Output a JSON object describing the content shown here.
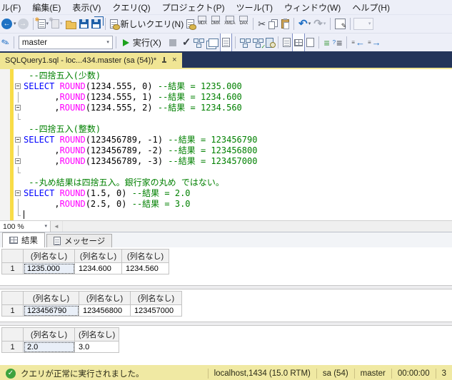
{
  "menu_bar": {
    "items": [
      "ル(F)",
      "編集(E)",
      "表示(V)",
      "クエリ(Q)",
      "プロジェクト(P)",
      "ツール(T)",
      "ウィンドウ(W)",
      "ヘルプ(H)"
    ]
  },
  "toolbar_main": {
    "new_query_label": "新しいクエリ(N)",
    "query_types": [
      "MDX",
      "DMX",
      "XMLA",
      "DAX"
    ]
  },
  "toolbar_editor": {
    "database": "master",
    "execute_label": "実行(X)"
  },
  "tab_strip": {
    "active_tab_title": "SQLQuery1.sql - loc...434.master (sa (54))*"
  },
  "editor": {
    "zoom_level": "100 %",
    "colors": {
      "keyword": "#0000FF",
      "function": "#FF00FF",
      "comment": "#008000",
      "change_bar": "#F8DC47"
    },
    "lines": [
      {
        "fold": "none",
        "segs": [
          [
            " --四捨五入(少数)",
            "cm"
          ]
        ]
      },
      {
        "fold": "minus",
        "segs": [
          [
            "SELECT ",
            "kw"
          ],
          [
            "ROUND",
            "fn"
          ],
          [
            "(1234.555, 0) ",
            "pl"
          ],
          [
            "--結果 = 1235.000",
            "cm"
          ]
        ]
      },
      {
        "fold": "line",
        "segs": [
          [
            "      ,",
            "pl"
          ],
          [
            "ROUND",
            "fn"
          ],
          [
            "(1234.555, 1) ",
            "pl"
          ],
          [
            "--結果 = 1234.600",
            "cm"
          ]
        ]
      },
      {
        "fold": "minus",
        "segs": [
          [
            "      ,",
            "pl"
          ],
          [
            "ROUND",
            "fn"
          ],
          [
            "(1234.555, 2) ",
            "pl"
          ],
          [
            "--結果 = 1234.560",
            "cm"
          ]
        ]
      },
      {
        "fold": "end",
        "segs": []
      },
      {
        "fold": "none",
        "segs": [
          [
            " --四捨五入(整数)",
            "cm"
          ]
        ]
      },
      {
        "fold": "minus",
        "segs": [
          [
            "SELECT ",
            "kw"
          ],
          [
            "ROUND",
            "fn"
          ],
          [
            "(123456789, -1) ",
            "pl"
          ],
          [
            "--結果 = 123456790",
            "cm"
          ]
        ]
      },
      {
        "fold": "line",
        "segs": [
          [
            "      ,",
            "pl"
          ],
          [
            "ROUND",
            "fn"
          ],
          [
            "(123456789, -2) ",
            "pl"
          ],
          [
            "--結果 = 123456800",
            "cm"
          ]
        ]
      },
      {
        "fold": "minus",
        "segs": [
          [
            "      ,",
            "pl"
          ],
          [
            "ROUND",
            "fn"
          ],
          [
            "(123456789, -3) ",
            "pl"
          ],
          [
            "--結果 = 123457000",
            "cm"
          ]
        ]
      },
      {
        "fold": "end",
        "segs": []
      },
      {
        "fold": "none",
        "segs": [
          [
            " --丸め結果は四捨五入。銀行家の丸め ではない。",
            "cm"
          ]
        ]
      },
      {
        "fold": "minus",
        "segs": [
          [
            "SELECT ",
            "kw"
          ],
          [
            "ROUND",
            "fn"
          ],
          [
            "(1.5, 0) ",
            "pl"
          ],
          [
            "--結果 = 2.0",
            "cm"
          ]
        ]
      },
      {
        "fold": "line",
        "segs": [
          [
            "      ,",
            "pl"
          ],
          [
            "ROUND",
            "fn"
          ],
          [
            "(2.5, 0) ",
            "pl"
          ],
          [
            "--結果 = 3.0",
            "cm"
          ]
        ]
      },
      {
        "fold": "end",
        "segs": [],
        "cursor": true
      }
    ]
  },
  "results": {
    "tab_results": "結果",
    "tab_messages": "メッセージ",
    "grids": [
      {
        "headers": [
          "(列名なし)",
          "(列名なし)",
          "(列名なし)"
        ],
        "row_number": "1",
        "cells": [
          "1235.000",
          "1234.600",
          "1234.560"
        ],
        "widths": [
          72,
          66,
          66
        ]
      },
      {
        "headers": [
          "(列名なし)",
          "(列名なし)",
          "(列名なし)"
        ],
        "row_number": "1",
        "cells": [
          "123456790",
          "123456800",
          "123457000"
        ],
        "widths": [
          78,
          72,
          72
        ]
      },
      {
        "headers": [
          "(列名なし)",
          "(列名なし)"
        ],
        "row_number": "1",
        "cells": [
          "2.0",
          "3.0"
        ],
        "widths": [
          72,
          62
        ]
      }
    ]
  },
  "status_bar": {
    "message": "クエリが正常に実行されました。",
    "segments": [
      "localhost,1434 (15.0 RTM)",
      "sa (54)",
      "master",
      "00:00:00",
      "3"
    ]
  },
  "icons": {
    "back": "←",
    "forward": "→",
    "cut": "✂",
    "undo": "↶",
    "redo": "↷",
    "check": "✓",
    "caret": "▾",
    "close": "×",
    "scroll_left": "◄",
    "pen": "✎",
    "comment": "≡",
    "uncomment": "≡",
    "indent": "→",
    "outdent": "←",
    "star": "✱"
  }
}
